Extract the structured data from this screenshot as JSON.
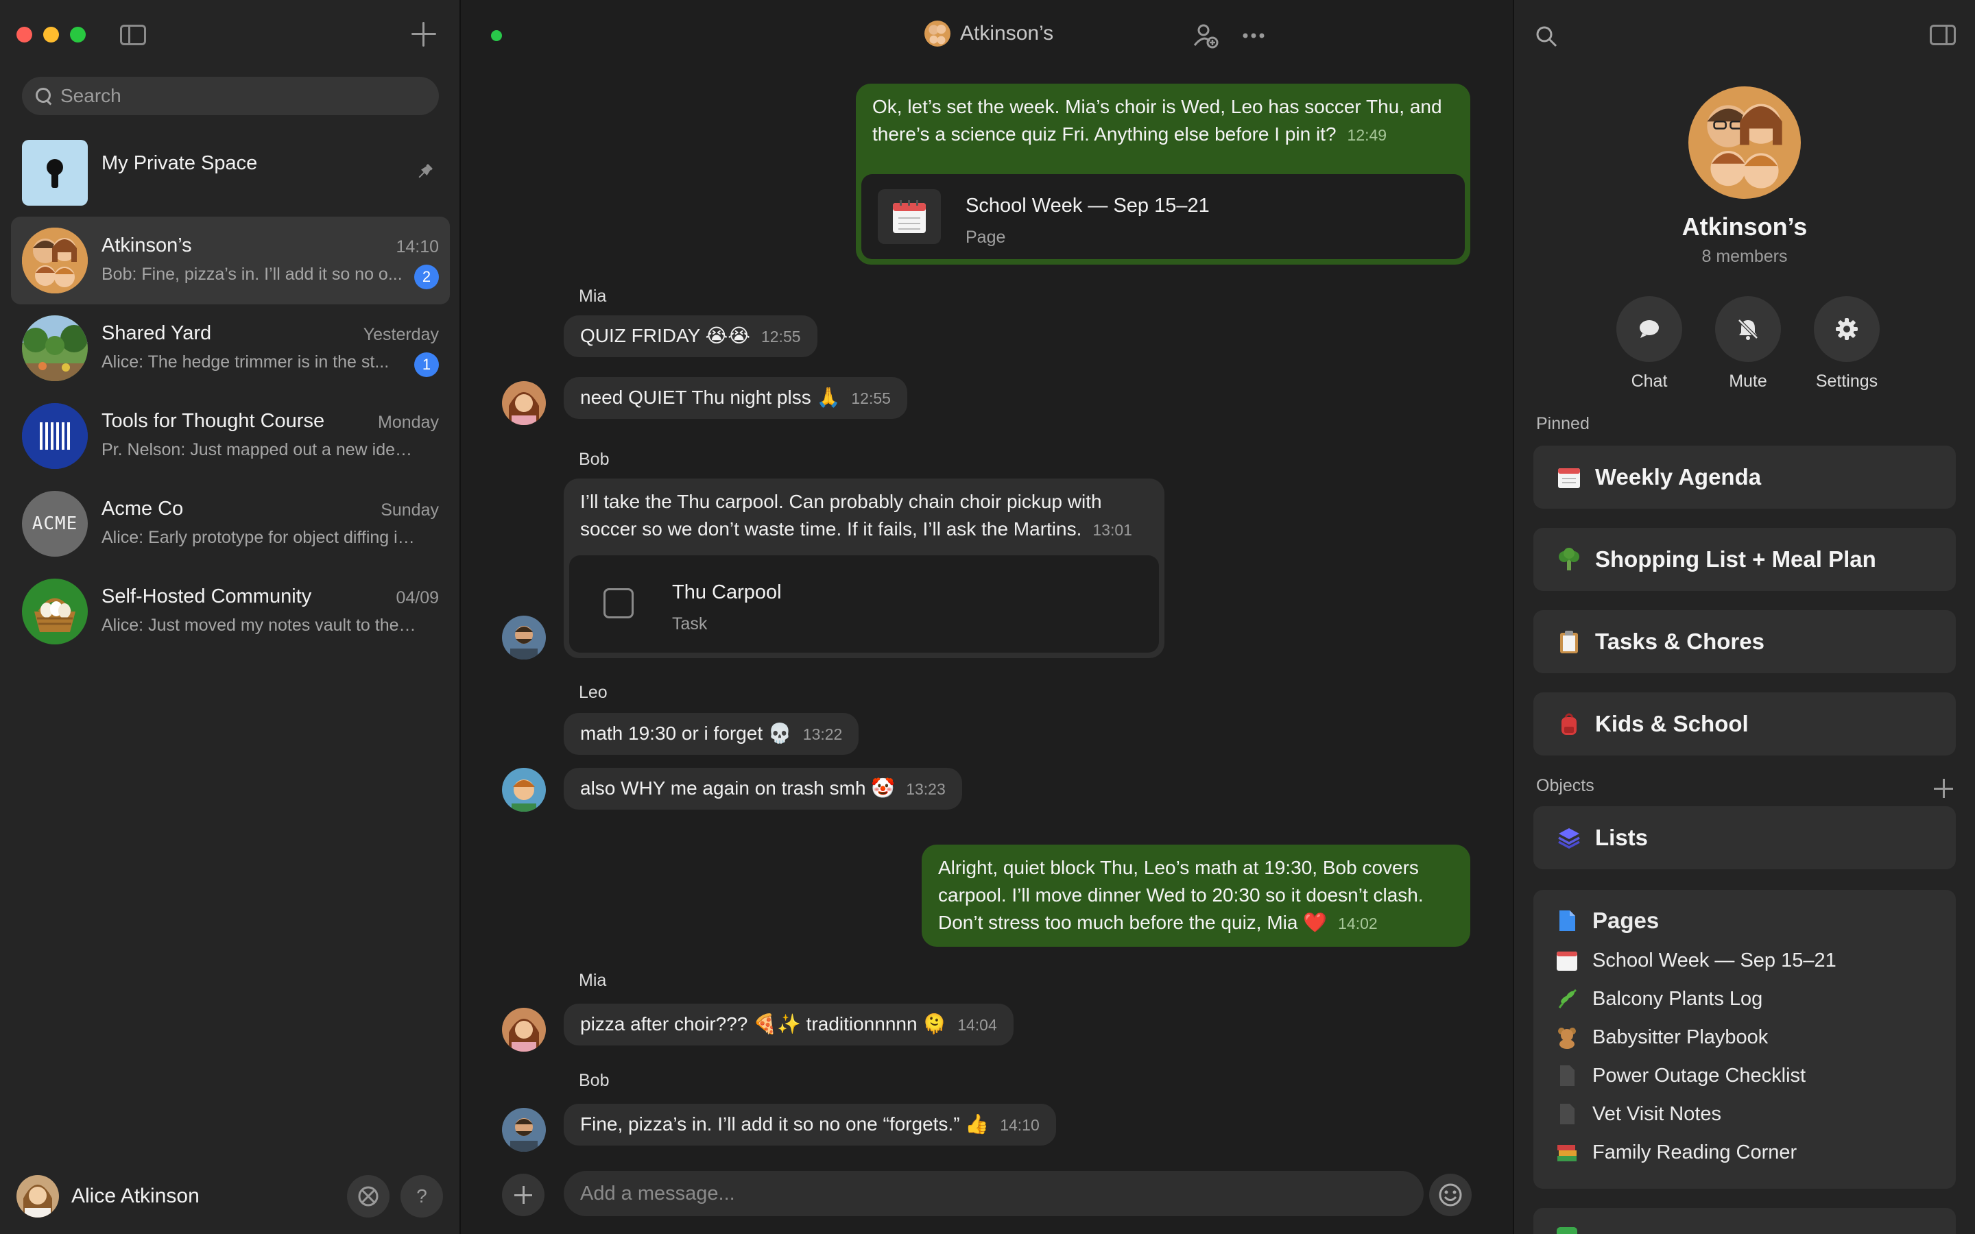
{
  "sidebar": {
    "search_placeholder": "Search",
    "private_space": "My Private Space",
    "chats": [
      {
        "name": "Atkinson’s",
        "time": "14:10",
        "preview": "Bob: Fine, pizza’s in. I’ll add it so no o...",
        "badge": "2"
      },
      {
        "name": "Shared Yard",
        "time": "Yesterday",
        "preview": "Alice: The hedge trimmer is in the st...",
        "badge": "1"
      },
      {
        "name": "Tools for Thought Course",
        "time": "Monday",
        "preview": "Pr. Nelson: Just mapped out a new idea s..."
      },
      {
        "name": "Acme Co",
        "time": "Sunday",
        "preview": "Alice: Early prototype for object diffing is...",
        "logo": "ACME"
      },
      {
        "name": "Self-Hosted Community",
        "time": "04/09",
        "preview": "Alice: Just moved my notes vault to the n..."
      }
    ],
    "user_name": "Alice Atkinson",
    "help": "?"
  },
  "main": {
    "title": "Atkinson’s",
    "messages": {
      "m1": {
        "text": "Ok, let’s set the week. Mia’s choir is Wed, Leo has soccer Thu, and there’s a science quiz Fri. Anything else before I pin it?",
        "time": "12:49",
        "card_title": "School Week — Sep 15–21",
        "card_type": "Page"
      },
      "m2": {
        "sender": "Mia",
        "text": "QUIZ FRIDAY 😭😭",
        "time": "12:55"
      },
      "m3": {
        "text": "need QUIET Thu night plss 🙏",
        "time": "12:55"
      },
      "m4": {
        "sender": "Bob",
        "text": "I’ll take the Thu carpool. Can probably chain choir pickup with soccer so we don’t waste time. If it fails, I’ll ask the Martins.",
        "time": "13:01",
        "card_title": "Thu Carpool",
        "card_type": "Task"
      },
      "m5": {
        "sender": "Leo",
        "text": "math 19:30 or i forget 💀",
        "time": "13:22"
      },
      "m6": {
        "text": "also WHY me again on trash smh 🤡",
        "time": "13:23"
      },
      "m7": {
        "text": "Alright, quiet block Thu, Leo’s math at 19:30, Bob covers carpool. I’ll move dinner Wed to 20:30 so it doesn’t clash. Don’t stress too much before the quiz, Mia ❤️",
        "time": "14:02"
      },
      "m8": {
        "sender": "Mia",
        "text": "pizza after choir??? 🍕✨ traditionnnnn 🫠",
        "time": "14:04"
      },
      "m9": {
        "sender": "Bob",
        "text": "Fine, pizza’s in. I’ll add it so no one “forgets.” 👍",
        "time": "14:10"
      }
    },
    "composer_placeholder": "Add a message..."
  },
  "panel": {
    "group_name": "Atkinson’s",
    "members": "8 members",
    "actions": [
      "Chat",
      "Mute",
      "Settings"
    ],
    "pinned_label": "Pinned",
    "pinned": [
      "Weekly Agenda",
      "Shopping List + Meal Plan",
      "Tasks & Chores",
      "Kids & School"
    ],
    "objects_label": "Objects",
    "lists_label": "Lists",
    "pages_label": "Pages",
    "pages": [
      "School Week — Sep 15–21",
      "Balcony Plants Log",
      "Babysitter Playbook",
      "Power Outage Checklist",
      "Vet Visit Notes",
      "Family Reading Corner"
    ]
  },
  "colors": {
    "outgoing_bubble": "#2d5a1b",
    "incoming_bubble": "#2f2f2f",
    "badge": "#3b82f6",
    "status_online": "#29c74a"
  },
  "icons": [
    "search-icon",
    "sidebar-toggle-icon",
    "plus-icon",
    "pin-icon",
    "add-member-icon",
    "more-icon",
    "emoji-icon",
    "chat-bubble-icon",
    "bell-off-icon",
    "gear-icon",
    "calendar-icon",
    "checkbox-icon",
    "layers-icon",
    "document-icon"
  ]
}
